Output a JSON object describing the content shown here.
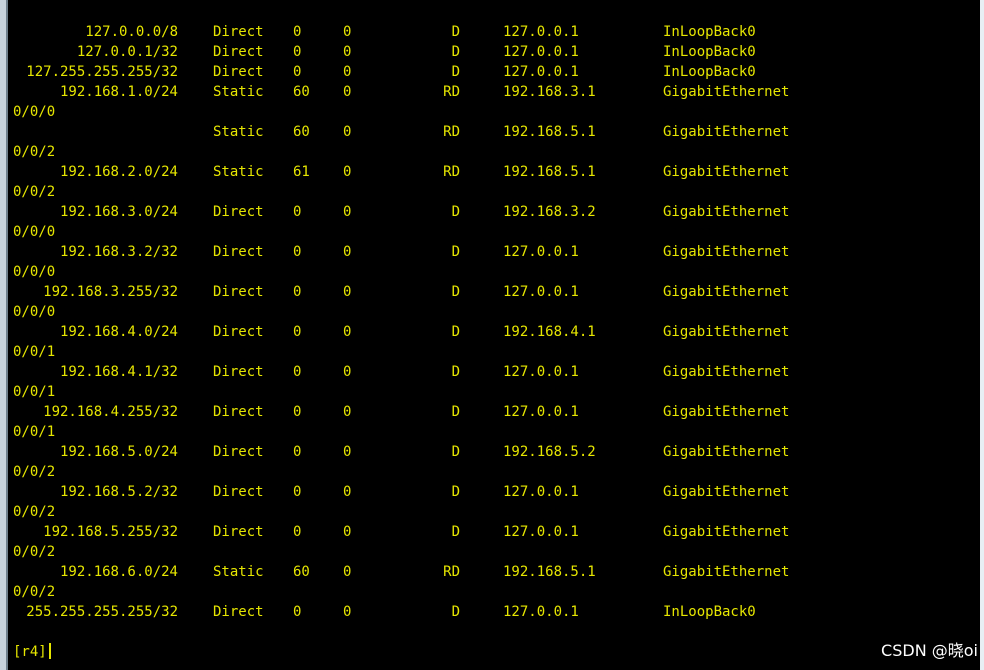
{
  "routes": [
    {
      "dest": "127.0.0.0/8",
      "proto": "Direct",
      "pre": "0",
      "cost": "0",
      "flags": "D",
      "nexthop": "127.0.0.1",
      "iface": "InLoopBack0",
      "wrap": ""
    },
    {
      "dest": "127.0.0.1/32",
      "proto": "Direct",
      "pre": "0",
      "cost": "0",
      "flags": "D",
      "nexthop": "127.0.0.1",
      "iface": "InLoopBack0",
      "wrap": ""
    },
    {
      "dest": "127.255.255.255/32",
      "proto": "Direct",
      "pre": "0",
      "cost": "0",
      "flags": "D",
      "nexthop": "127.0.0.1",
      "iface": "InLoopBack0",
      "wrap": ""
    },
    {
      "dest": "192.168.1.0/24",
      "proto": "Static",
      "pre": "60",
      "cost": "0",
      "flags": "RD",
      "nexthop": "192.168.3.1",
      "iface": "GigabitEthernet",
      "wrap": "0/0/0"
    },
    {
      "dest": "",
      "proto": "Static",
      "pre": "60",
      "cost": "0",
      "flags": "RD",
      "nexthop": "192.168.5.1",
      "iface": "GigabitEthernet",
      "wrap": "0/0/2"
    },
    {
      "dest": "192.168.2.0/24",
      "proto": "Static",
      "pre": "61",
      "cost": "0",
      "flags": "RD",
      "nexthop": "192.168.5.1",
      "iface": "GigabitEthernet",
      "wrap": "0/0/2"
    },
    {
      "dest": "192.168.3.0/24",
      "proto": "Direct",
      "pre": "0",
      "cost": "0",
      "flags": "D",
      "nexthop": "192.168.3.2",
      "iface": "GigabitEthernet",
      "wrap": "0/0/0"
    },
    {
      "dest": "192.168.3.2/32",
      "proto": "Direct",
      "pre": "0",
      "cost": "0",
      "flags": "D",
      "nexthop": "127.0.0.1",
      "iface": "GigabitEthernet",
      "wrap": "0/0/0"
    },
    {
      "dest": "192.168.3.255/32",
      "proto": "Direct",
      "pre": "0",
      "cost": "0",
      "flags": "D",
      "nexthop": "127.0.0.1",
      "iface": "GigabitEthernet",
      "wrap": "0/0/0"
    },
    {
      "dest": "192.168.4.0/24",
      "proto": "Direct",
      "pre": "0",
      "cost": "0",
      "flags": "D",
      "nexthop": "192.168.4.1",
      "iface": "GigabitEthernet",
      "wrap": "0/0/1"
    },
    {
      "dest": "192.168.4.1/32",
      "proto": "Direct",
      "pre": "0",
      "cost": "0",
      "flags": "D",
      "nexthop": "127.0.0.1",
      "iface": "GigabitEthernet",
      "wrap": "0/0/1"
    },
    {
      "dest": "192.168.4.255/32",
      "proto": "Direct",
      "pre": "0",
      "cost": "0",
      "flags": "D",
      "nexthop": "127.0.0.1",
      "iface": "GigabitEthernet",
      "wrap": "0/0/1"
    },
    {
      "dest": "192.168.5.0/24",
      "proto": "Direct",
      "pre": "0",
      "cost": "0",
      "flags": "D",
      "nexthop": "192.168.5.2",
      "iface": "GigabitEthernet",
      "wrap": "0/0/2"
    },
    {
      "dest": "192.168.5.2/32",
      "proto": "Direct",
      "pre": "0",
      "cost": "0",
      "flags": "D",
      "nexthop": "127.0.0.1",
      "iface": "GigabitEthernet",
      "wrap": "0/0/2"
    },
    {
      "dest": "192.168.5.255/32",
      "proto": "Direct",
      "pre": "0",
      "cost": "0",
      "flags": "D",
      "nexthop": "127.0.0.1",
      "iface": "GigabitEthernet",
      "wrap": "0/0/2"
    },
    {
      "dest": "192.168.6.0/24",
      "proto": "Static",
      "pre": "60",
      "cost": "0",
      "flags": "RD",
      "nexthop": "192.168.5.1",
      "iface": "GigabitEthernet",
      "wrap": "0/0/2"
    },
    {
      "dest": "255.255.255.255/32",
      "proto": "Direct",
      "pre": "0",
      "cost": "0",
      "flags": "D",
      "nexthop": "127.0.0.1",
      "iface": "InLoopBack0",
      "wrap": ""
    }
  ],
  "prompt": "[r4]",
  "watermark": "CSDN @晓oi",
  "colors": {
    "background": "#000000",
    "text": "#e6e600"
  }
}
